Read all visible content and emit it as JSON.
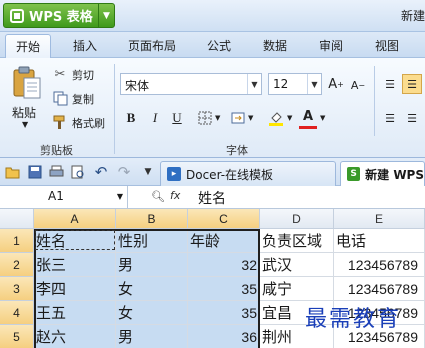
{
  "titlebar": {
    "app_name": "WPS 表格",
    "doc_title": "新建"
  },
  "menu": {
    "tabs": [
      "开始",
      "插入",
      "页面布局",
      "公式",
      "数据",
      "审阅",
      "视图"
    ]
  },
  "ribbon": {
    "clipboard": {
      "paste": "粘贴",
      "cut": "剪切",
      "copy": "复制",
      "format_painter": "格式刷",
      "group_label": "剪贴板"
    },
    "font": {
      "font_name": "宋体",
      "font_size": "12",
      "bold": "B",
      "italic": "I",
      "underline": "U",
      "group_label": "字体"
    }
  },
  "quickbar": {
    "tabs": [
      {
        "label": "Docer-在线模板"
      },
      {
        "label": "新建 WPS"
      }
    ]
  },
  "formula_bar": {
    "name_box": "A1",
    "fx": "fx",
    "content": "姓名"
  },
  "sheet": {
    "columns": [
      "A",
      "B",
      "C",
      "D",
      "E"
    ],
    "rows": [
      "1",
      "2",
      "3",
      "4",
      "5"
    ],
    "cells": [
      [
        "姓名",
        "性别",
        "年龄",
        "负责区域",
        "电话"
      ],
      [
        "张三",
        "男",
        "32",
        "武汉",
        "123456789"
      ],
      [
        "李四",
        "女",
        "35",
        "咸宁",
        "123456789"
      ],
      [
        "王五",
        "女",
        "35",
        "宜昌",
        "123456789"
      ],
      [
        "赵六",
        "男",
        "36",
        "荆州",
        "123456789"
      ]
    ]
  },
  "watermark": "最需教育",
  "colors": {
    "accent_green": "#4aa321",
    "selection": "#c7dcf2",
    "header_selected": "#f5cf80",
    "watermark": "#1a3fb8"
  }
}
